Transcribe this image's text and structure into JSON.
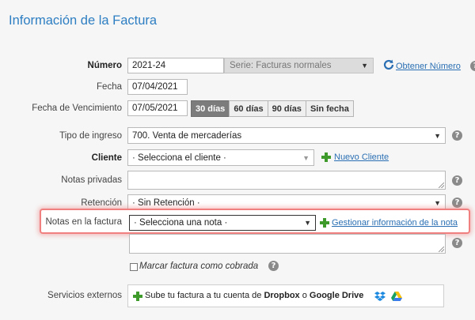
{
  "page_title": "Información de la Factura",
  "numero": {
    "label": "Número",
    "value": "2021-24",
    "serie": "Serie: Facturas normales",
    "obtener_link": "Obtener Número"
  },
  "fecha": {
    "label": "Fecha",
    "value": "07/04/2021"
  },
  "vencimiento": {
    "label": "Fecha de Vencimiento",
    "value": "07/05/2021",
    "buttons": [
      "30 días",
      "60 días",
      "90 días",
      "Sin fecha"
    ],
    "active_button": "30 días"
  },
  "tipo_ingreso": {
    "label": "Tipo de ingreso",
    "value": "700. Venta de mercaderías"
  },
  "cliente": {
    "label": "Cliente",
    "placeholder": "· Selecciona el cliente ·",
    "nuevo_link": "Nuevo Cliente"
  },
  "notas_privadas": {
    "label": "Notas privadas",
    "value": ""
  },
  "retencion": {
    "label": "Retención",
    "value": "· Sin Retención ·"
  },
  "notas_factura": {
    "label": "Notas en la factura",
    "value": "· Selecciona una nota ·",
    "gestionar_link": "Gestionar información de la nota"
  },
  "marcar_cobrada": {
    "label": "Marcar factura como cobrada",
    "checked": false
  },
  "servicios": {
    "label": "Servicios externos",
    "text_prefix": "Sube tu factura a tu cuenta de ",
    "dropbox": "Dropbox",
    "connector": " o ",
    "gdrive": "Google Drive"
  },
  "colors": {
    "title": "#2d7ec2",
    "link": "#2a6fb3",
    "plus": "#3d9a2b",
    "highlight": "#f08080"
  }
}
